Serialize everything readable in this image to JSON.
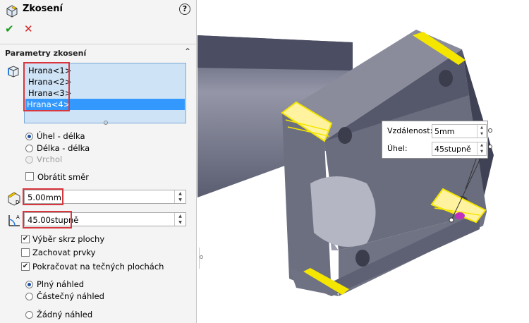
{
  "window": {
    "title": "Zkosení",
    "help_glyph": "?"
  },
  "actions": {
    "ok_glyph": "✔",
    "cancel_glyph": "✕"
  },
  "section": {
    "title": "Parametry zkosení",
    "collapse_glyph": "⌃"
  },
  "edges": {
    "items": [
      "Hrana<1>",
      "Hrana<2>",
      "Hrana<3>",
      "Hrana<4>"
    ],
    "selected_index": 3
  },
  "chamfer_type": {
    "options": [
      {
        "label": "Úhel - délka",
        "checked": true,
        "enabled": true
      },
      {
        "label": "Délka - délka",
        "checked": false,
        "enabled": true
      },
      {
        "label": "Vrchol",
        "checked": false,
        "enabled": false
      }
    ]
  },
  "flip_direction": {
    "label": "Obrátit směr",
    "checked": false
  },
  "distance": {
    "value": "5.00mm"
  },
  "angle": {
    "value": "45.00stupně"
  },
  "options": [
    {
      "label": "Výběr skrz plochy",
      "checked": true
    },
    {
      "label": "Zachovat prvky",
      "checked": false
    },
    {
      "label": "Pokračovat na tečných plochách",
      "checked": true
    }
  ],
  "preview": {
    "options": [
      {
        "label": "Plný náhled",
        "checked": true
      },
      {
        "label": "Částečný náhled",
        "checked": false
      },
      {
        "label": "Žádný náhled",
        "checked": false
      }
    ]
  },
  "callout": {
    "distance_label": "Vzdálenost:",
    "distance_value": "5mm",
    "angle_label": "Úhel:",
    "angle_value": "45stupně"
  },
  "colors": {
    "selection_highlight": "#d9373f",
    "list_selected": "#3399ff",
    "part_face": "#5b5e70",
    "edge_preview": "#f5e600",
    "ok": "#1a9a1a",
    "cancel": "#d02020"
  },
  "icons": {
    "header": "chamfer-feature-icon",
    "edges": "edge-selection-icon",
    "distance": "distance-icon",
    "angle": "angle-icon"
  }
}
